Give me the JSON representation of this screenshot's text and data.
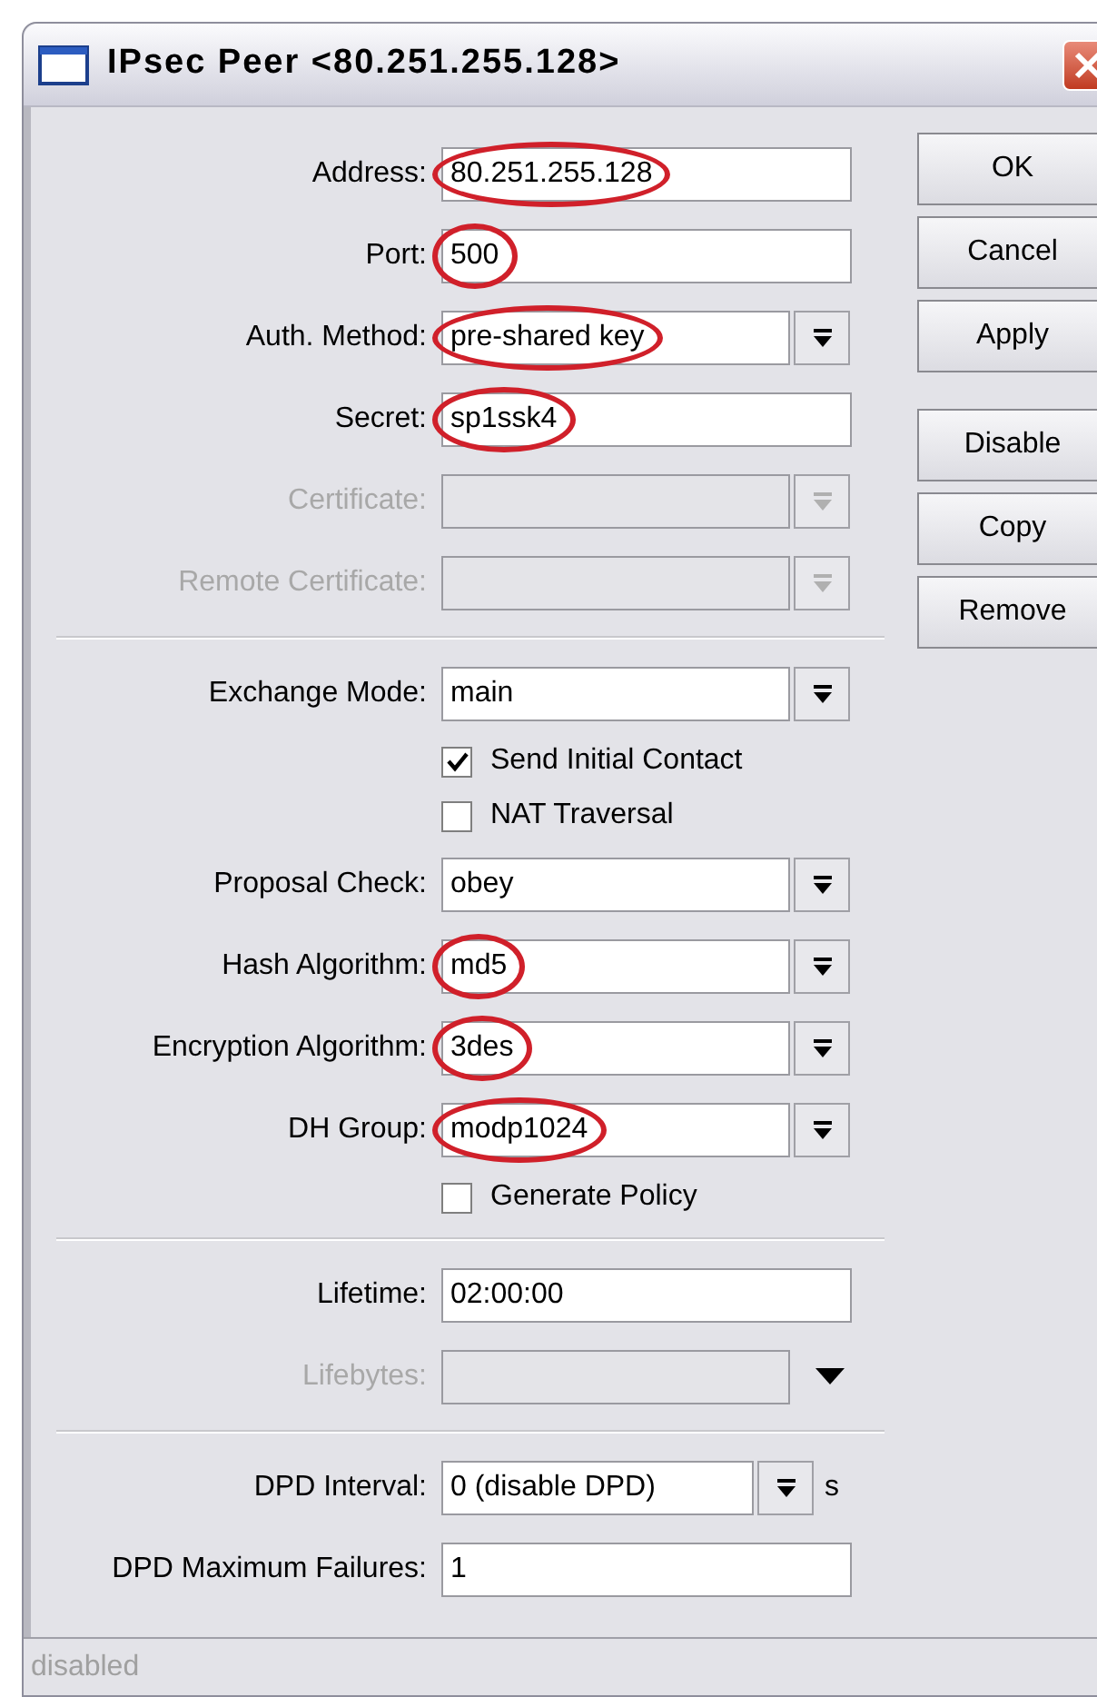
{
  "window": {
    "title": "IPsec Peer <80.251.255.128>"
  },
  "fields": [
    {
      "kind": "text",
      "label": "Address:",
      "value": "80.251.255.128",
      "circled": true,
      "disabled": false
    },
    {
      "kind": "text",
      "label": "Port:",
      "value": "500",
      "circled": true,
      "disabled": false
    },
    {
      "kind": "select",
      "label": "Auth. Method:",
      "value": "pre-shared key",
      "circled": true,
      "disabled": false
    },
    {
      "kind": "text",
      "label": "Secret:",
      "value": "sp1ssk4",
      "circled": true,
      "disabled": false
    },
    {
      "kind": "select",
      "label": "Certificate:",
      "disabled": true
    },
    {
      "kind": "select",
      "label": "Remote Certificate:",
      "disabled": true
    },
    {
      "kind": "divider"
    },
    {
      "kind": "select",
      "label": "Exchange Mode:",
      "value": "main",
      "circled": false,
      "disabled": false
    },
    {
      "kind": "checkbox",
      "label": "Send Initial Contact",
      "checked": true
    },
    {
      "kind": "checkbox",
      "label": "NAT Traversal",
      "checked": false
    },
    {
      "kind": "select",
      "label": "Proposal Check:",
      "value": "obey",
      "circled": false,
      "disabled": false
    },
    {
      "kind": "select",
      "label": "Hash Algorithm:",
      "value": "md5",
      "circled": true,
      "disabled": false
    },
    {
      "kind": "select",
      "label": "Encryption Algorithm:",
      "value": "3des",
      "circled": true,
      "disabled": false
    },
    {
      "kind": "select",
      "label": "DH Group:",
      "value": "modp1024",
      "circled": true,
      "disabled": false
    },
    {
      "kind": "checkbox",
      "label": "Generate Policy",
      "checked": false
    },
    {
      "kind": "divider"
    },
    {
      "kind": "text",
      "label": "Lifetime:",
      "value": "02:00:00",
      "circled": false,
      "disabled": false
    },
    {
      "kind": "expand",
      "label": "Lifebytes:",
      "disabled": true
    },
    {
      "kind": "divider"
    },
    {
      "kind": "select",
      "label": "DPD Interval:",
      "value": "0 (disable DPD)",
      "unit": "s",
      "circled": false,
      "disabled": false
    },
    {
      "kind": "text",
      "label": "DPD Maximum Failures:",
      "value": "1",
      "circled": false,
      "disabled": false
    }
  ],
  "buttons": [
    {
      "label": "OK",
      "kind": "action"
    },
    {
      "label": "Cancel",
      "kind": "action"
    },
    {
      "label": "Apply",
      "kind": "action"
    },
    {
      "label": "Disable",
      "kind": "extra"
    },
    {
      "label": "Copy",
      "kind": "action"
    },
    {
      "label": "Remove",
      "kind": "action"
    }
  ],
  "status_bar": {
    "text": "disabled"
  }
}
